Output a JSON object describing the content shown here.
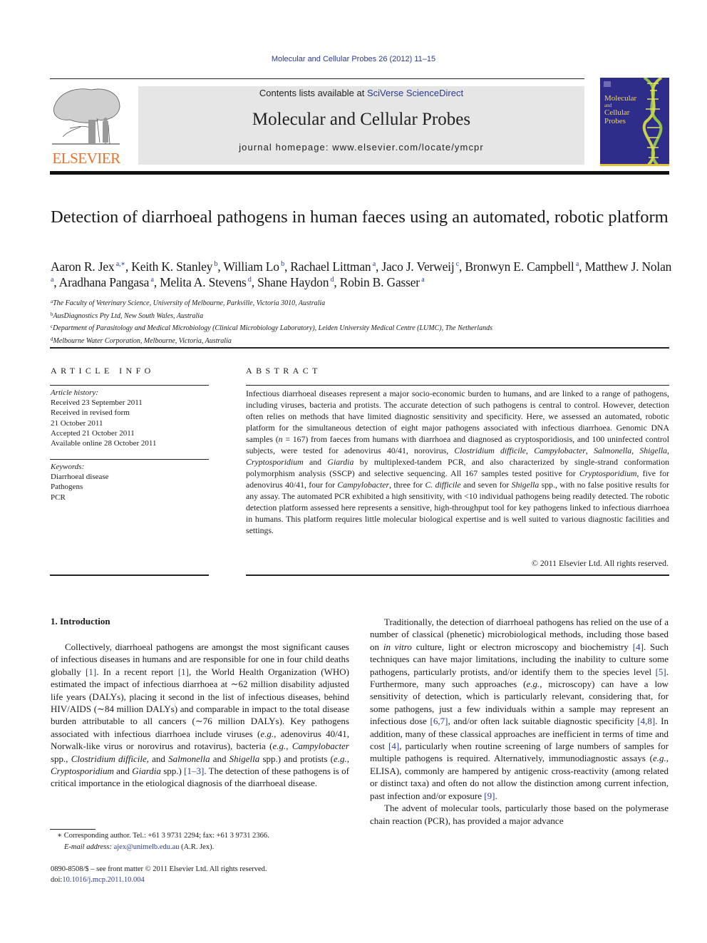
{
  "header": {
    "citation": "Molecular and Cellular Probes 26 (2012) 11–15",
    "contents_prefix": "Contents lists available at ",
    "contents_link": "SciVerse ScienceDirect",
    "journal_title": "Molecular and Cellular Probes",
    "homepage": "journal homepage: www.elsevier.com/locate/ymcpr",
    "publisher_logo_text": "ELSEVIER",
    "cover": {
      "title_line1": "Molecular",
      "title_line2": "and",
      "title_line3": "Cellular",
      "title_line4": "Probes",
      "background_color": "#2f2d8a",
      "accent_color": "#e2c13a"
    }
  },
  "article": {
    "title": "Detection of diarrhoeal pathogens in human faeces using an automated, robotic platform",
    "authors": [
      {
        "name": "Aaron R. Jex",
        "aff": "a,∗"
      },
      {
        "name": "Keith K. Stanley",
        "aff": "b"
      },
      {
        "name": "William Lo",
        "aff": "b"
      },
      {
        "name": "Rachael Littman",
        "aff": "a"
      },
      {
        "name": "Jaco J. Verweij",
        "aff": "c"
      },
      {
        "name": "Bronwyn E. Campbell",
        "aff": "a"
      },
      {
        "name": "Matthew J. Nolan",
        "aff": "a"
      },
      {
        "name": "Aradhana Pangasa",
        "aff": "a"
      },
      {
        "name": "Melita A. Stevens",
        "aff": "d"
      },
      {
        "name": "Shane Haydon",
        "aff": "d"
      },
      {
        "name": "Robin B. Gasser",
        "aff": "a"
      }
    ],
    "affiliations": [
      {
        "key": "a",
        "text": "The Faculty of Veterinary Science, University of Melbourne, Parkville, Victoria 3010, Australia"
      },
      {
        "key": "b",
        "text": "AusDiagnostics Pty Ltd, New South Wales, Australia"
      },
      {
        "key": "c",
        "text": "Department of Parasitology and Medical Microbiology (Clinical Microbiology Laboratory), Leiden University Medical Centre (LUMC), The Netherlands"
      },
      {
        "key": "d",
        "text": "Melbourne Water Corporation, Melbourne, Victoria, Australia"
      }
    ]
  },
  "article_info": {
    "heading": "ARTICLE INFO",
    "history_label": "Article history:",
    "history": [
      "Received 23 September 2011",
      "Received in revised form",
      "21 October 2011",
      "Accepted 21 October 2011",
      "Available online 28 October 2011"
    ],
    "keywords_label": "Keywords:",
    "keywords": [
      "Diarrhoeal disease",
      "Pathogens",
      "PCR"
    ]
  },
  "abstract": {
    "heading": "ABSTRACT",
    "segments": [
      {
        "t": "Infectious diarrhoeal diseases represent a major socio-economic burden to humans, and are linked to a range of pathogens, including viruses, bacteria and protists. The accurate detection of such pathogens is central to control. However, detection often relies on methods that have limited diagnostic sensitivity and specificity. Here, we assessed an automated, robotic platform for the simultaneous detection of eight major pathogens associated with infectious diarrhoea. Genomic DNA samples ("
      },
      {
        "t": "n",
        "i": true
      },
      {
        "t": " = 167) from faeces from humans with diarrhoea and diagnosed as cryptosporidiosis, and 100 uninfected control subjects, were tested for adenovirus 40/41, norovirus, "
      },
      {
        "t": "Clostridium difficile",
        "i": true
      },
      {
        "t": ", "
      },
      {
        "t": "Campylobacter",
        "i": true
      },
      {
        "t": ", "
      },
      {
        "t": "Salmonella",
        "i": true
      },
      {
        "t": ", "
      },
      {
        "t": "Shigella",
        "i": true
      },
      {
        "t": ", "
      },
      {
        "t": "Cryptosporidium",
        "i": true
      },
      {
        "t": " and "
      },
      {
        "t": "Giardia",
        "i": true
      },
      {
        "t": " by multiplexed-tandem PCR, and also characterized by single-strand conformation polymorphism analysis (SSCP) and selective sequencing. All 167 samples tested positive for "
      },
      {
        "t": "Cryptosporidium",
        "i": true
      },
      {
        "t": ", five for adenovirus 40/41, four for "
      },
      {
        "t": "Campylobacter",
        "i": true
      },
      {
        "t": ", three for "
      },
      {
        "t": "C. difficile",
        "i": true
      },
      {
        "t": " and seven for "
      },
      {
        "t": "Shigella",
        "i": true
      },
      {
        "t": " spp., with no false positive results for any assay. The automated PCR exhibited a high sensitivity, with <10 individual pathogens being readily detected. The robotic detection platform assessed here represents a sensitive, high-throughput tool for key pathogens linked to infectious diarrhoea in humans. This platform requires little molecular biological expertise and is well suited to various diagnostic facilities and settings."
      }
    ],
    "copyright": "© 2011 Elsevier Ltd. All rights reserved."
  },
  "introduction": {
    "heading": "1.  Introduction",
    "left_paragraphs": [
      [
        {
          "t": "Collectively, diarrhoeal pathogens are amongst the most significant causes of infectious diseases in humans and are responsible for one in four child deaths globally "
        },
        {
          "t": "[1]",
          "r": true
        },
        {
          "t": ". In a recent report "
        },
        {
          "t": "[1]",
          "r": true
        },
        {
          "t": ", the World Health Organization (WHO) estimated the impact of infectious diarrhoea at ∼62 million disability adjusted life years (DALYs), placing it second in the list of infectious diseases, behind HIV/AIDS (∼84 million DALYs) and comparable in impact to the total disease burden attributable to all cancers (∼76 million DALYs). Key pathogens associated with infectious diarrhoea include viruses ("
        },
        {
          "t": "e.g.",
          "i": true
        },
        {
          "t": ", adenovirus 40/41, Norwalk-like virus or norovirus and rotavirus), bacteria ("
        },
        {
          "t": "e.g.",
          "i": true
        },
        {
          "t": ", "
        },
        {
          "t": "Campylobacter",
          "i": true
        },
        {
          "t": " spp., "
        },
        {
          "t": "Clostridium difficile",
          "i": true
        },
        {
          "t": ", and "
        },
        {
          "t": "Salmonella",
          "i": true
        },
        {
          "t": " and "
        },
        {
          "t": "Shigella",
          "i": true
        },
        {
          "t": " spp.) and protists ("
        },
        {
          "t": "e.g.",
          "i": true
        },
        {
          "t": ", "
        },
        {
          "t": "Cryptosporidium",
          "i": true
        },
        {
          "t": " and "
        },
        {
          "t": "Giardia",
          "i": true
        },
        {
          "t": " spp.) "
        },
        {
          "t": "[1–3]",
          "r": true
        },
        {
          "t": ". The detection of these pathogens is of critical importance in the etiological diagnosis of the diarrhoeal disease."
        }
      ]
    ],
    "right_paragraphs": [
      [
        {
          "t": "Traditionally, the detection of diarrhoeal pathogens has relied on the use of a number of classical (phenetic) microbiological methods, including those based on "
        },
        {
          "t": "in vitro",
          "i": true
        },
        {
          "t": " culture, light or electron microscopy and biochemistry "
        },
        {
          "t": "[4]",
          "r": true
        },
        {
          "t": ". Such techniques can have major limitations, including the inability to culture some pathogens, particularly protists, and/or identify them to the species level "
        },
        {
          "t": "[5]",
          "r": true
        },
        {
          "t": ". Furthermore, many such approaches ("
        },
        {
          "t": "e.g.",
          "i": true
        },
        {
          "t": ", microscopy) can have a low sensitivity of detection, which is particularly relevant, considering that, for some pathogens, just a few individuals within a sample may represent an infectious dose "
        },
        {
          "t": "[6,7]",
          "r": true
        },
        {
          "t": ", and/or often lack suitable diagnostic specificity "
        },
        {
          "t": "[4,8]",
          "r": true
        },
        {
          "t": ". In addition, many of these classical approaches are inefficient in terms of time and cost "
        },
        {
          "t": "[4]",
          "r": true
        },
        {
          "t": ", particularly when routine screening of large numbers of samples for multiple pathogens is required. Alternatively, immunodiagnostic assays ("
        },
        {
          "t": "e.g.",
          "i": true
        },
        {
          "t": ", ELISA), commonly are hampered by antigenic cross-reactivity (among related or distinct taxa) and often do not allow the distinction among current infection, past infection and/or exposure "
        },
        {
          "t": "[9]",
          "r": true
        },
        {
          "t": "."
        }
      ],
      [
        {
          "t": "The advent of molecular tools, particularly those based on the polymerase chain reaction (PCR), has provided a major advance"
        }
      ]
    ]
  },
  "footnotes": {
    "corresponding": "∗  Corresponding author. Tel.: +61 3 9731 2294; fax: +61 3 9731 2366.",
    "email_label": "E-mail address:",
    "email": "ajex@unimelb.edu.au",
    "email_suffix": " (A.R. Jex).",
    "front_matter": "0890-8508/$ – see front matter © 2011 Elsevier Ltd. All rights reserved.",
    "doi_label": "doi:",
    "doi": "10.1016/j.mcp.2011.10.004"
  },
  "colors": {
    "link": "#2a3b8f",
    "elsevier_orange": "#e8722b",
    "masthead_bg": "#e6e6e6"
  }
}
